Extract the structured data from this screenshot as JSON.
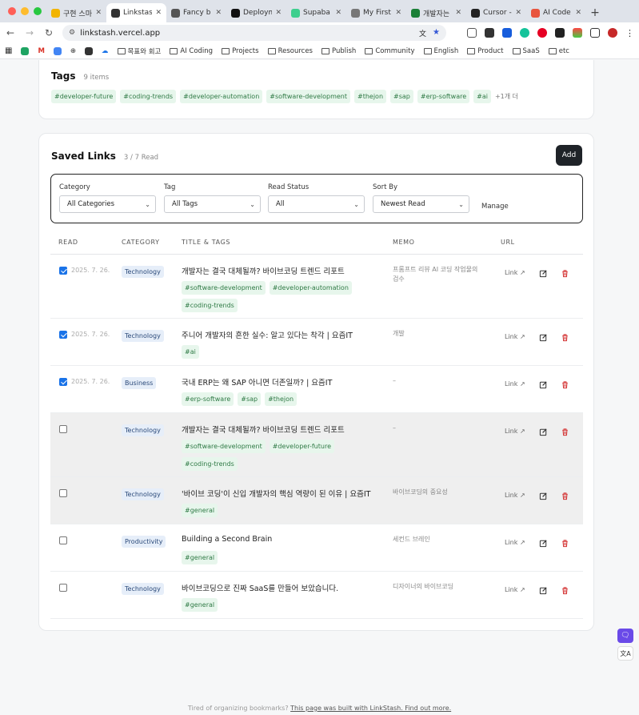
{
  "browser": {
    "tabs": [
      {
        "label": "구현 스마",
        "color": "#f2b400"
      },
      {
        "label": "Linkstas",
        "color": "#333333",
        "active": true
      },
      {
        "label": "Fancy b",
        "color": "#555555"
      },
      {
        "label": "Deploym",
        "color": "#111111"
      },
      {
        "label": "Supaba",
        "color": "#3ecf8e"
      },
      {
        "label": "My First",
        "color": "#777777"
      },
      {
        "label": "개발자는",
        "color": "#1a7f37"
      },
      {
        "label": "Cursor -",
        "color": "#222222"
      },
      {
        "label": "AI Code",
        "color": "#e8553e"
      }
    ],
    "new_tab": "+",
    "url": "linkstash.vercel.app",
    "bookmarks": [
      "목표와 회고",
      "AI Coding",
      "Projects",
      "Resources",
      "Publish",
      "Community",
      "English",
      "Product",
      "SaaS",
      "etc"
    ]
  },
  "tags": {
    "title": "Tags",
    "count": "9 items",
    "items": [
      "#developer-future",
      "#coding-trends",
      "#developer-automation",
      "#software-development",
      "#thejon",
      "#sap",
      "#erp-software",
      "#ai"
    ],
    "more": "+1개 더"
  },
  "saved_links": {
    "title": "Saved Links",
    "read_count": "3 / 7 Read",
    "add_label": "Add",
    "filters": {
      "category": {
        "label": "Category",
        "value": "All Categories"
      },
      "tag": {
        "label": "Tag",
        "value": "All Tags"
      },
      "read_status": {
        "label": "Read Status",
        "value": "All"
      },
      "sort_by": {
        "label": "Sort By",
        "value": "Newest Read"
      },
      "manage": "Manage"
    },
    "columns": {
      "read": "READ",
      "category": "CATEGORY",
      "title": "TITLE & TAGS",
      "memo": "MEMO",
      "url": "URL"
    },
    "rows": [
      {
        "read": true,
        "date": "2025. 7. 26.",
        "category": "Technology",
        "title": "개발자는 결국 대체될까? 바이브코딩 트렌드 리포트",
        "tags": [
          "#software-development",
          "#developer-automation",
          "#coding-trends"
        ],
        "memo": "프롬프트 리뷰 AI 코딩 작업물의 검수",
        "link": "Link"
      },
      {
        "read": true,
        "date": "2025. 7. 26.",
        "category": "Technology",
        "title": "주니어 개발자의 흔한 실수: 알고 있다는 착각 | 요즘IT",
        "tags": [
          "#ai"
        ],
        "memo": "개발",
        "link": "Link"
      },
      {
        "read": true,
        "date": "2025. 7. 26.",
        "category": "Business",
        "title": "국내 ERP는 왜 SAP 아니면 더존일까? | 요즘IT",
        "tags": [
          "#erp-software",
          "#sap",
          "#thejon"
        ],
        "memo": "–",
        "link": "Link"
      },
      {
        "read": false,
        "date": "",
        "category": "Technology",
        "title": "개발자는 결국 대체될까? 바이브코딩 트렌드 리포트",
        "tags": [
          "#software-development",
          "#developer-future",
          "#coding-trends"
        ],
        "memo": "–",
        "link": "Link"
      },
      {
        "read": false,
        "date": "",
        "category": "Technology",
        "title": "'바이브 코딩'이 신입 개발자의 핵심 역량이 된 이유 | 요즘IT",
        "tags": [
          "#general"
        ],
        "memo": "바이브코딩의 중요성",
        "link": "Link"
      },
      {
        "read": false,
        "date": "",
        "category": "Productivity",
        "title": "Building a Second Brain",
        "tags": [
          "#general"
        ],
        "memo": "세컨드 브레인",
        "link": "Link"
      },
      {
        "read": false,
        "date": "",
        "category": "Technology",
        "title": "바이브코딩으로 진짜 SaaS를 만들어 보았습니다.",
        "tags": [
          "#general"
        ],
        "memo": "디자이너의 바이브코딩",
        "link": "Link"
      }
    ]
  },
  "footer": {
    "text": "Tired of organizing bookmarks?",
    "link": "This page was built with LinkStash. Find out more."
  },
  "widget": {
    "top": "🗨",
    "bottom": "文A"
  }
}
